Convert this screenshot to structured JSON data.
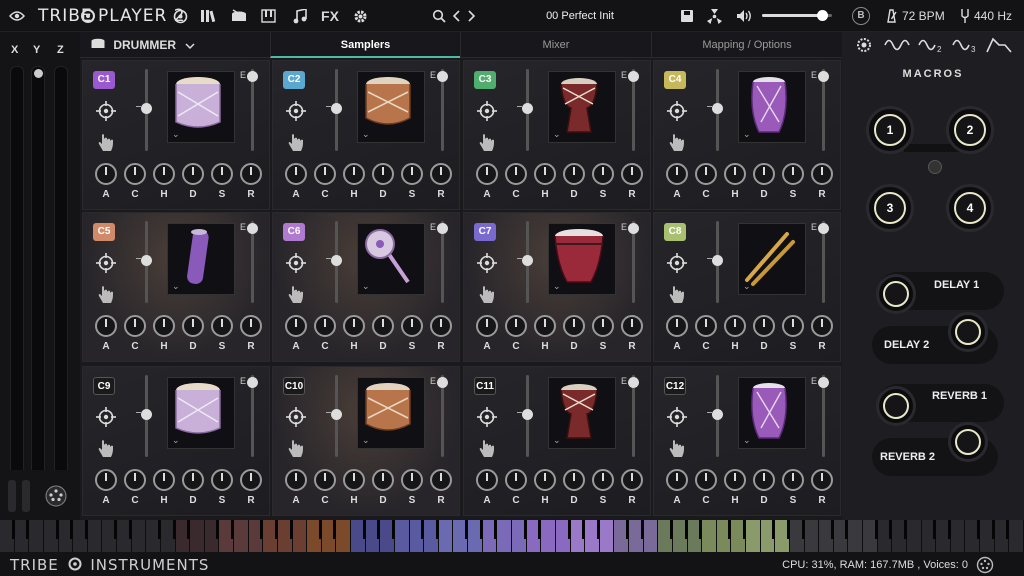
{
  "topbar": {
    "logo_left": "TRIBE",
    "logo_right": "PLAYER 2",
    "fx_label": "FX",
    "preset_name": "00 Perfect Init",
    "volume_level": 0.85,
    "bpm": "72 BPM",
    "tuning": "440 Hz",
    "metronome_label": "B"
  },
  "xyz": {
    "x_label": "X",
    "y_label": "Y",
    "z_label": "Z"
  },
  "header": {
    "instrument": "DRUMMER",
    "tabs": [
      {
        "label": "Samplers",
        "active": true
      },
      {
        "label": "Mixer",
        "active": false
      },
      {
        "label": "Mapping / Options",
        "active": false
      }
    ]
  },
  "knob_labels": [
    "A",
    "C",
    "H",
    "D",
    "S",
    "R"
  ],
  "edit_label": "E",
  "cells": [
    {
      "id": "C1",
      "color": "#9b59d0",
      "drum": "snare-white"
    },
    {
      "id": "C2",
      "color": "#5aa8d0",
      "drum": "tom-brown"
    },
    {
      "id": "C3",
      "color": "#4fae6e",
      "drum": "djembe"
    },
    {
      "id": "C4",
      "color": "#c7b85a",
      "drum": "conga-purple"
    },
    {
      "id": "C5",
      "color": "#d08a6a",
      "drum": "shaker"
    },
    {
      "id": "C6",
      "color": "#b07ad0",
      "drum": "rattle"
    },
    {
      "id": "C7",
      "color": "#7a6ad0",
      "drum": "red-drum"
    },
    {
      "id": "C8",
      "color": "#a8c070",
      "drum": "sticks"
    },
    {
      "id": "C9",
      "color": "#1a1a1a",
      "drum": "snare-white"
    },
    {
      "id": "C10",
      "color": "#1a1a1a",
      "drum": "tom-brown"
    },
    {
      "id": "C11",
      "color": "#1a1a1a",
      "drum": "djembe"
    },
    {
      "id": "C12",
      "color": "#1a1a1a",
      "drum": "conga-purple"
    }
  ],
  "right_panel": {
    "macros_title": "MACROS",
    "macros": [
      "1",
      "2",
      "3",
      "4"
    ],
    "delay1": "DELAY 1",
    "delay2": "DELAY 2",
    "reverb1": "REVERB 1",
    "reverb2": "REVERB 2"
  },
  "status": {
    "brand_left": "TRIBE",
    "brand_right": "INSTRUMENTS",
    "text": "CPU: 31%, RAM: 167.7MB , Voices: 0"
  }
}
